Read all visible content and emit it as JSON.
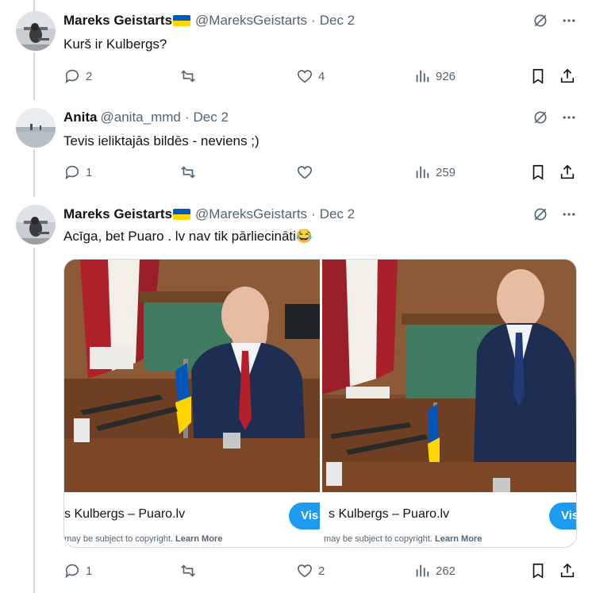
{
  "tweets": [
    {
      "author": "Mareks Geistarts",
      "handle": "@MareksGeistarts",
      "date": "Dec 2",
      "text": "Kurš ir Kulbergs?",
      "replies": "2",
      "retweets": "",
      "likes": "4",
      "views": "926"
    },
    {
      "author": "Anita",
      "handle": "@anita_mmd",
      "date": "Dec 2",
      "text": "Tevis ieliktajās bildēs - neviens ;)",
      "replies": "1",
      "retweets": "",
      "likes": "",
      "views": "259"
    },
    {
      "author": "Mareks Geistarts",
      "handle": "@MareksGeistarts",
      "date": "Dec 2",
      "text": "Acīga, bet Puaro . lv  nav tik pārliecināti😂",
      "replies": "1",
      "retweets": "",
      "likes": "2",
      "views": "262"
    }
  ],
  "media": [
    {
      "link_title": "s Kulbergs – Puaro.lv",
      "copyright": "may be subject to copyright.",
      "learn_more": "Learn More",
      "visit_label": "Vis"
    },
    {
      "link_title": "s Kulbergs – Puaro.lv",
      "copyright": "may be subject to copyright.",
      "learn_more": "Learn More",
      "visit_label": "Vis"
    }
  ],
  "colors": {
    "text": "#0f1419",
    "secondary": "#536471",
    "accent": "#1d9bf0",
    "divider": "#cfd9de",
    "flag_blue": "#005bbb",
    "flag_yellow": "#ffd500"
  },
  "icons": [
    "grok-icon",
    "more-icon",
    "reply-icon",
    "retweet-icon",
    "like-icon",
    "views-icon",
    "bookmark-icon",
    "share-icon",
    "ukraine-flag-icon"
  ]
}
